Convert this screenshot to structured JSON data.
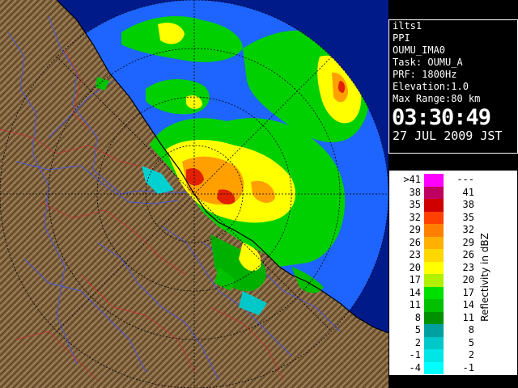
{
  "info_panel": {
    "lines": [
      "ilts1",
      "PPI",
      "OUMU_IMA0",
      "Task: OUMU_A",
      "PRF: 1800Hz",
      "Elevation:1.0",
      "Max Range:80 km"
    ],
    "time": "03:30:49",
    "date": "27 JUL 2009 JST"
  },
  "legend": {
    "title": "Reflectivity in dBZ",
    "rows": [
      {
        "lo": ">41",
        "hi": "---",
        "color": "#ff00ff"
      },
      {
        "lo": "38",
        "hi": "41",
        "color": "#c00060"
      },
      {
        "lo": "35",
        "hi": "38",
        "color": "#d00000"
      },
      {
        "lo": "32",
        "hi": "35",
        "color": "#ff4000"
      },
      {
        "lo": "29",
        "hi": "32",
        "color": "#ff8000"
      },
      {
        "lo": "26",
        "hi": "29",
        "color": "#ffb000"
      },
      {
        "lo": "23",
        "hi": "26",
        "color": "#ffd800"
      },
      {
        "lo": "20",
        "hi": "23",
        "color": "#ffff00"
      },
      {
        "lo": "17",
        "hi": "20",
        "color": "#b0f000"
      },
      {
        "lo": "14",
        "hi": "17",
        "color": "#00e000"
      },
      {
        "lo": "11",
        "hi": "14",
        "color": "#00c000"
      },
      {
        "lo": "8",
        "hi": "11",
        "color": "#009000"
      },
      {
        "lo": "5",
        "hi": "8",
        "color": "#00a0a0"
      },
      {
        "lo": "2",
        "hi": "5",
        "color": "#00c8c8"
      },
      {
        "lo": "-1",
        "hi": "2",
        "color": "#00e6e6"
      },
      {
        "lo": "-4",
        "hi": "-1",
        "color": "#00ffff"
      }
    ]
  },
  "map": {
    "sea_color": "#1e64ff",
    "outer_color": "#001a8a",
    "land_color": "#8a6a40",
    "river_color": "#4a58d8",
    "boundary_color": "#c83030"
  }
}
